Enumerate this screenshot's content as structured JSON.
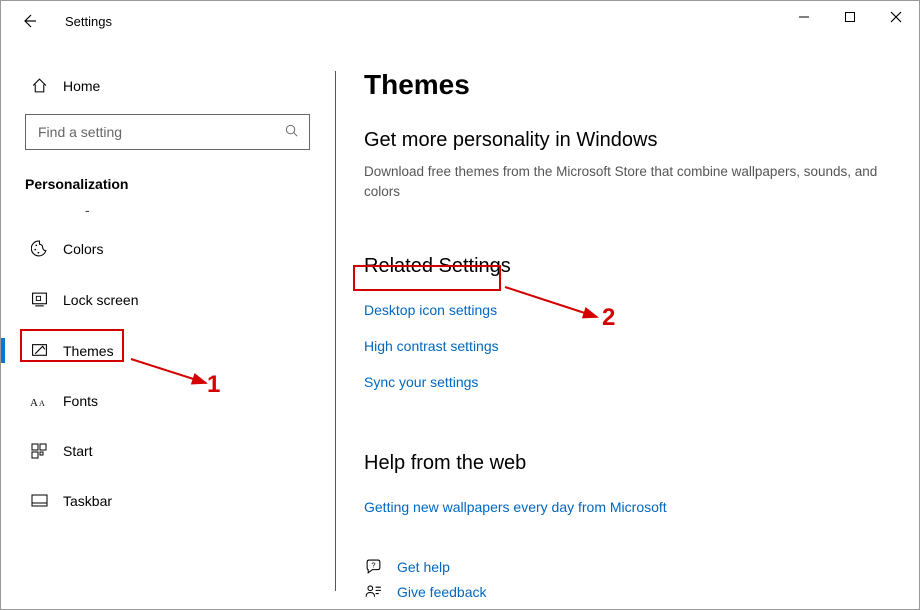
{
  "window": {
    "title": "Settings"
  },
  "sidebar": {
    "home_label": "Home",
    "search_placeholder": "Find a setting",
    "category": "Personalization",
    "items": [
      {
        "label": "Colors"
      },
      {
        "label": "Lock screen"
      },
      {
        "label": "Themes"
      },
      {
        "label": "Fonts"
      },
      {
        "label": "Start"
      },
      {
        "label": "Taskbar"
      }
    ]
  },
  "main": {
    "title": "Themes",
    "more_personality_title": "Get more personality in Windows",
    "more_personality_desc": "Download free themes from the Microsoft Store that combine wallpapers, sounds, and colors",
    "related_title": "Related Settings",
    "related_links": {
      "desktop_icon": "Desktop icon settings",
      "high_contrast": "High contrast settings",
      "sync": "Sync your settings"
    },
    "help_title": "Help from the web",
    "help_link": "Getting new wallpapers every day from Microsoft",
    "footer": {
      "get_help": "Get help",
      "give_feedback": "Give feedback"
    }
  },
  "annotations": {
    "label1": "1",
    "label2": "2"
  }
}
